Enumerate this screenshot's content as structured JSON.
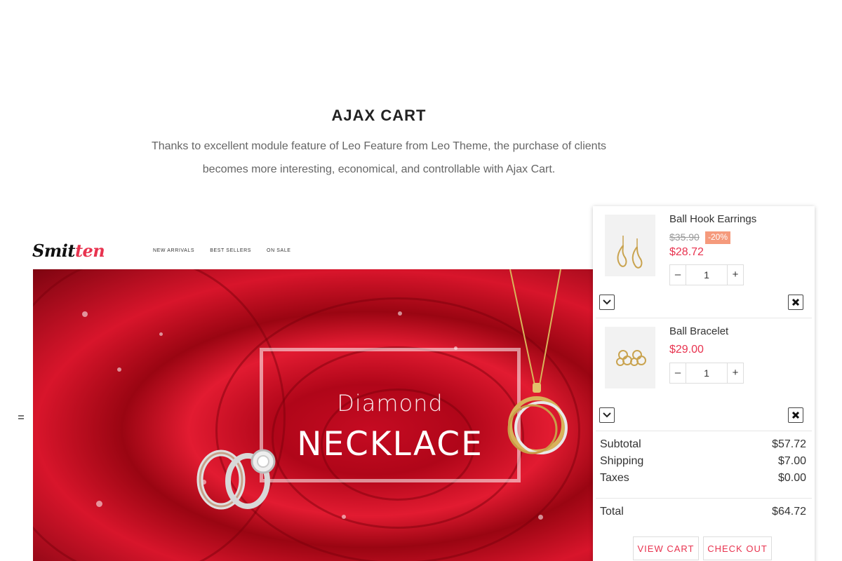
{
  "section": {
    "title": "AJAX CART",
    "description_line1": "Thanks to excellent module feature of Leo Feature from Leo Theme, the purchase of clients",
    "description_line2": "becomes more interesting, economical, and controllable with Ajax Cart."
  },
  "store": {
    "logo_part1": "Smit",
    "logo_part2": "ten",
    "nav": [
      "NEW ARRIVALS",
      "BEST SELLERS",
      "ON SALE"
    ]
  },
  "banner": {
    "subtitle": "Diamond",
    "title": "NECKLACE"
  },
  "cart": {
    "items": [
      {
        "name": "Ball Hook Earrings",
        "old_price": "$35.90",
        "discount": "-20%",
        "price": "$28.72",
        "quantity": "1",
        "icon": "earrings-icon"
      },
      {
        "name": "Ball Bracelet",
        "price": "$29.00",
        "quantity": "1",
        "icon": "bracelet-icon"
      }
    ],
    "summary": {
      "subtotal_label": "Subtotal",
      "subtotal": "$57.72",
      "shipping_label": "Shipping",
      "shipping": "$7.00",
      "taxes_label": "Taxes",
      "taxes": "$0.00",
      "total_label": "Total",
      "total": "$64.72"
    },
    "view_cart": "VIEW CART",
    "check_out": "CHECK OUT"
  },
  "colors": {
    "accent": "#e8334f",
    "discount": "#f59a7c"
  }
}
